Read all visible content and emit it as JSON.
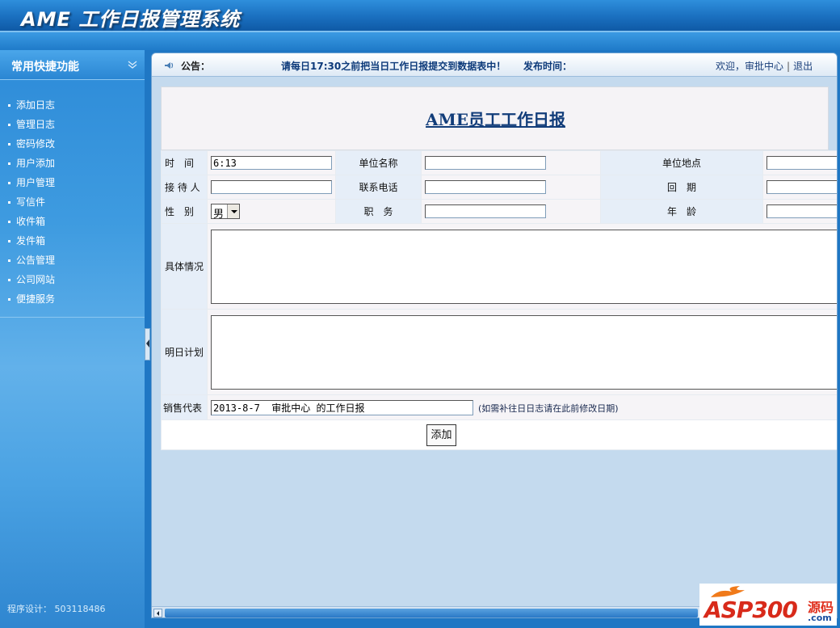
{
  "app": {
    "title": "AME 工作日报管理系统"
  },
  "sidebar": {
    "title": "常用快捷功能",
    "items": [
      {
        "label": "添加日志"
      },
      {
        "label": "管理日志"
      },
      {
        "label": "密码修改"
      },
      {
        "label": "用户添加"
      },
      {
        "label": "用户管理"
      },
      {
        "label": "写信件"
      },
      {
        "label": "收件箱"
      },
      {
        "label": "发件箱"
      },
      {
        "label": "公告管理"
      },
      {
        "label": "公司网站"
      },
      {
        "label": "便捷服务"
      }
    ],
    "credit": "程序设计： 503118486"
  },
  "notice": {
    "label": "公告：",
    "text": "请每日17:30之前把当日工作日报提交到数据表中！",
    "time_label": "发布时间：",
    "welcome": "欢迎，",
    "user": "审批中心",
    "logout": "退出"
  },
  "report": {
    "title": "AME员工工作日报",
    "fields": {
      "time_label": "时　间",
      "time_value": "6:13",
      "unit_name_label": "单位名称",
      "unit_name_value": "",
      "unit_location_label": "单位地点",
      "unit_location_value": "",
      "receiver_label": "接 待 人",
      "receiver_value": "",
      "phone_label": "联系电话",
      "phone_value": "",
      "revisit_label": "回　期",
      "revisit_value": "",
      "gender_label": "性　别",
      "gender_value": "男",
      "position_label": "职　务",
      "position_value": "",
      "age_label": "年　龄",
      "age_value": "",
      "details_label": "具体情况",
      "plan_label": "明日计划",
      "sales_rep_label": "销售代表",
      "sales_rep_value": "2013-8-7  审批中心 的工作日报",
      "sales_rep_hint": "(如需补往日日志请在此前修改日期)"
    },
    "submit_label": "添加"
  },
  "watermark": {
    "brand": "ASP300",
    "suffix": "源码",
    "domain": ".com"
  }
}
